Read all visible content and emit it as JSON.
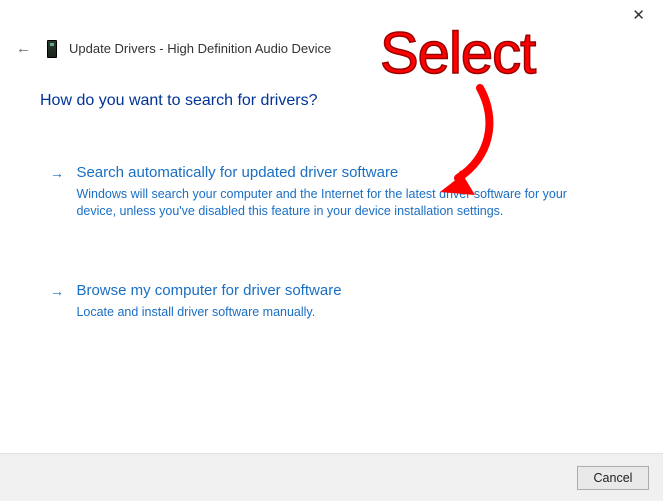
{
  "window": {
    "title": "Update Drivers - High Definition Audio Device"
  },
  "main": {
    "question": "How do you want to search for drivers?"
  },
  "options": [
    {
      "title": "Search automatically for updated driver software",
      "desc": "Windows will search your computer and the Internet for the latest driver software for your device, unless you've disabled this feature in your device installation settings."
    },
    {
      "title": "Browse my computer for driver software",
      "desc": "Locate and install driver software manually."
    }
  ],
  "footer": {
    "cancel": "Cancel"
  },
  "annotation": {
    "label": "Select"
  }
}
